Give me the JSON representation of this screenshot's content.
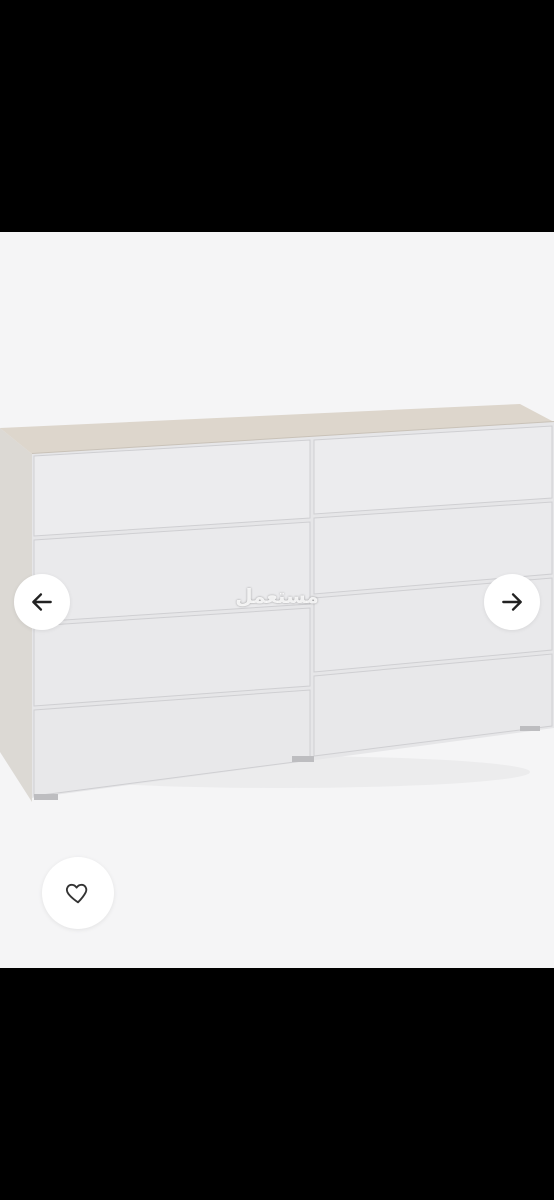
{
  "viewer": {
    "background": "#f5f5f6",
    "watermark_text": "مستعمل",
    "product": {
      "type": "chest-of-drawers",
      "drawer_columns": 2,
      "drawers_per_column": 4,
      "front_color": "#e9e9eb",
      "top_color": "#ddd6cc"
    }
  },
  "controls": {
    "prev_icon": "arrow-left-icon",
    "next_icon": "arrow-right-icon",
    "favorite_icon": "heart-icon"
  }
}
